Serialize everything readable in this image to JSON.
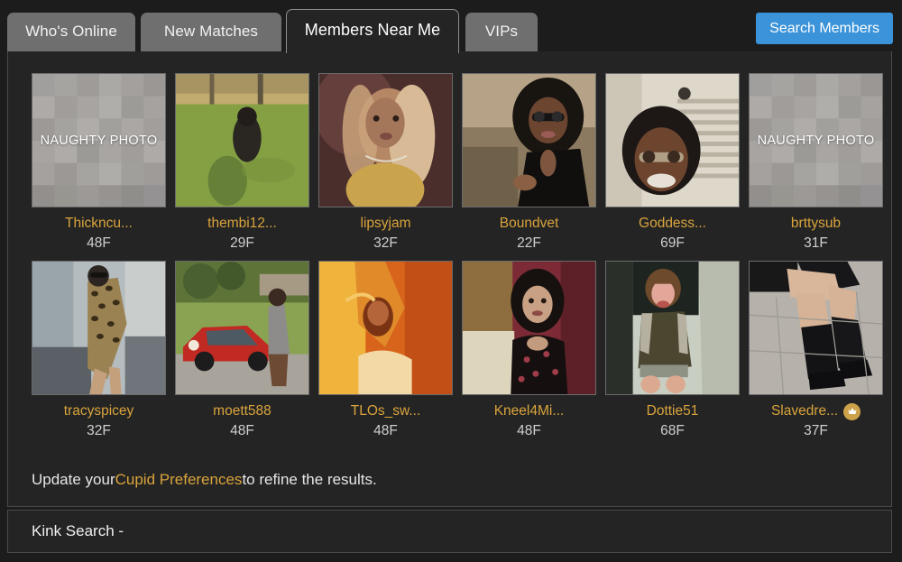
{
  "tabs": [
    {
      "label": "Who's Online",
      "active": false
    },
    {
      "label": "New Matches",
      "active": false
    },
    {
      "label": "Members Near Me",
      "active": true
    },
    {
      "label": "VIPs",
      "active": false
    }
  ],
  "toolbar": {
    "search_members_label": "Search Members"
  },
  "colors": {
    "accent_gold": "#d9a43c",
    "button_blue": "#3b93d9",
    "panel_bg": "#242424",
    "page_bg": "#1c1c1c",
    "tab_inactive": "#6f6f6f"
  },
  "members": [
    [
      {
        "username": "Thickncu...",
        "age": "48F",
        "photo": "censored",
        "censored_label": "NAUGHTY PHOTO",
        "vip": false
      },
      {
        "username": "thembi12...",
        "age": "29F",
        "photo": "woman-on-grass-lawn",
        "vip": false
      },
      {
        "username": "lipsyjam",
        "age": "32F",
        "photo": "woman-blonde-hair-closeup",
        "vip": false
      },
      {
        "username": "Boundvet",
        "age": "22F",
        "photo": "woman-glasses-black-jacket-couch",
        "vip": false
      },
      {
        "username": "Goddess...",
        "age": "69F",
        "photo": "woman-glasses-smiling-blinds",
        "vip": false
      },
      {
        "username": "brttysub",
        "age": "31F",
        "photo": "censored",
        "censored_label": "NAUGHTY PHOTO",
        "vip": false
      }
    ],
    [
      {
        "username": "tracyspicey",
        "age": "32F",
        "photo": "woman-leopard-dress-kitchen",
        "vip": false
      },
      {
        "username": "moett588",
        "age": "48F",
        "photo": "woman-gray-dress-red-car",
        "vip": false
      },
      {
        "username": "TLOs_sw...",
        "age": "48F",
        "photo": "woman-orange-warm-light-bed",
        "vip": false
      },
      {
        "username": "Kneel4Mi...",
        "age": "48F",
        "photo": "woman-dark-hair-floral-top",
        "vip": false
      },
      {
        "username": "Dottie51",
        "age": "68F",
        "photo": "woman-seated-in-car-door",
        "vip": false
      },
      {
        "username": "Slavedre...",
        "age": "37F",
        "photo": "legs-in-black-boots-pavement",
        "vip": true,
        "badge": "crown-badge"
      }
    ]
  ],
  "footer": {
    "prefix": "Update your ",
    "link_label": "Cupid Preferences",
    "suffix": " to refine the results."
  },
  "kink_search": {
    "label": "Kink Search -"
  }
}
